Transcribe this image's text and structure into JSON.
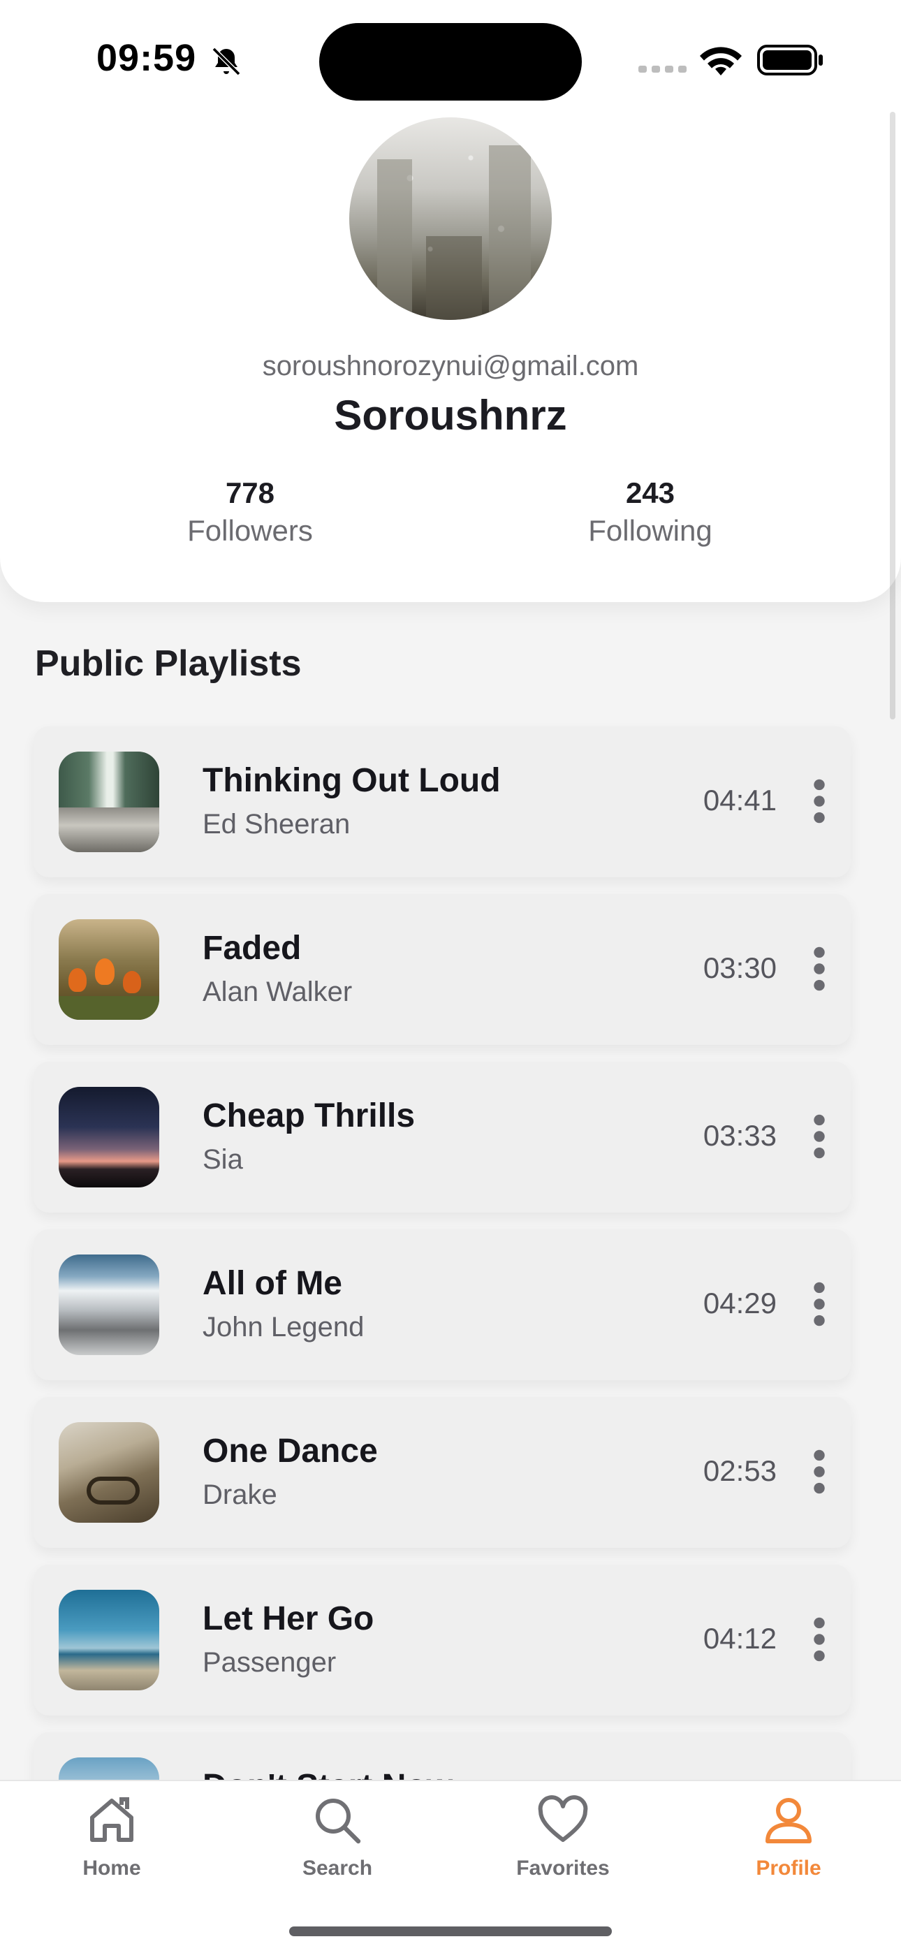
{
  "status_bar": {
    "time": "09:59",
    "icons": [
      "bell-slash-icon",
      "cellular-signal-icon",
      "wifi-icon",
      "battery-icon"
    ]
  },
  "profile": {
    "email": "soroushnorozynui@gmail.com",
    "name": "Soroushnrz",
    "followers": {
      "count": "778",
      "label": "Followers"
    },
    "following": {
      "count": "243",
      "label": "Following"
    }
  },
  "playlists": {
    "title": "Public Playlists",
    "tracks": [
      {
        "title": "Thinking Out Loud",
        "artist": "Ed Sheeran",
        "duration": "04:41",
        "thumb": "waterfall"
      },
      {
        "title": "Faded",
        "artist": "Alan Walker",
        "duration": "03:30",
        "thumb": "tulips"
      },
      {
        "title": "Cheap Thrills",
        "artist": "Sia",
        "duration": "03:33",
        "thumb": "dusk-mountains"
      },
      {
        "title": "All of Me",
        "artist": "John Legend",
        "duration": "04:29",
        "thumb": "snowy-valley"
      },
      {
        "title": "One Dance",
        "artist": "Drake",
        "duration": "02:53",
        "thumb": "street-bicycle"
      },
      {
        "title": "Let Her Go",
        "artist": "Passenger",
        "duration": "04:12",
        "thumb": "beach"
      },
      {
        "title": "Don't Start Now",
        "artist": "",
        "duration": "",
        "thumb": "desert"
      }
    ]
  },
  "bottom_nav": {
    "items": [
      {
        "label": "Home",
        "icon": "home-icon",
        "active": false
      },
      {
        "label": "Search",
        "icon": "search-icon",
        "active": false
      },
      {
        "label": "Favorites",
        "icon": "heart-icon",
        "active": false
      },
      {
        "label": "Profile",
        "icon": "user-icon",
        "active": true
      }
    ]
  },
  "colors": {
    "accent": "#f2883a",
    "background": "#f4f4f4",
    "card": "#efefef",
    "text_primary": "#16161c",
    "text_secondary": "#5f5f66"
  }
}
